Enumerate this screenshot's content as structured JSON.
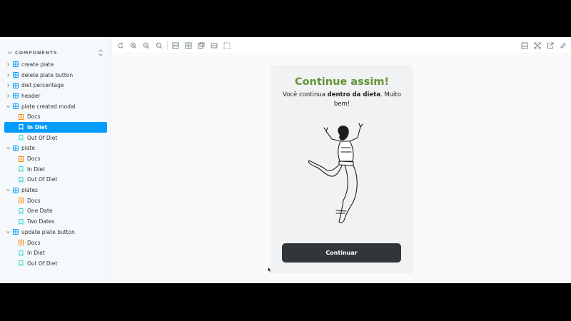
{
  "sidebar": {
    "title": "COMPONENTS",
    "items": [
      {
        "label": "create plate",
        "kind": "component",
        "expanded": false
      },
      {
        "label": "delete plate button",
        "kind": "component",
        "expanded": false
      },
      {
        "label": "diet percentage",
        "kind": "component",
        "expanded": false
      },
      {
        "label": "header",
        "kind": "component",
        "expanded": false
      },
      {
        "label": "plate created modal",
        "kind": "component",
        "expanded": true
      },
      {
        "label": "Docs",
        "kind": "docs"
      },
      {
        "label": "In Diet",
        "kind": "story",
        "selected": true
      },
      {
        "label": "Out Of Diet",
        "kind": "story"
      },
      {
        "label": "plate",
        "kind": "component",
        "expanded": true
      },
      {
        "label": "Docs",
        "kind": "docs"
      },
      {
        "label": "In Diet",
        "kind": "story"
      },
      {
        "label": "Out Of Diet",
        "kind": "story"
      },
      {
        "label": "plates",
        "kind": "component",
        "expanded": true
      },
      {
        "label": "Docs",
        "kind": "docs"
      },
      {
        "label": "One Date",
        "kind": "story"
      },
      {
        "label": "Two Dates",
        "kind": "story"
      },
      {
        "label": "update plate button",
        "kind": "component",
        "expanded": true
      },
      {
        "label": "Docs",
        "kind": "docs"
      },
      {
        "label": "In Diet",
        "kind": "story"
      },
      {
        "label": "Out Of Diet",
        "kind": "story"
      }
    ]
  },
  "toolbar": {
    "left_icons": [
      "reload-icon",
      "zoom-in-icon",
      "zoom-out-icon",
      "zoom-reset-icon",
      "background-icon",
      "grid-icon",
      "viewport-icon",
      "measure-icon",
      "outline-icon"
    ],
    "right_icons": [
      "panel-toggle-icon",
      "fullscreen-icon",
      "open-new-tab-icon",
      "copy-link-icon"
    ]
  },
  "modal": {
    "title": "Continue assim!",
    "text_before": "Você continua ",
    "text_bold": "dentro da dieta",
    "text_after": ". Muito bem!",
    "button_label": "Continuar"
  },
  "colors": {
    "accent": "#029cfd",
    "title_green": "#639339",
    "button_dark": "#333638",
    "component_icon": "#029cfd",
    "docs_icon": "#ff8300",
    "story_icon": "#37d5d3"
  }
}
